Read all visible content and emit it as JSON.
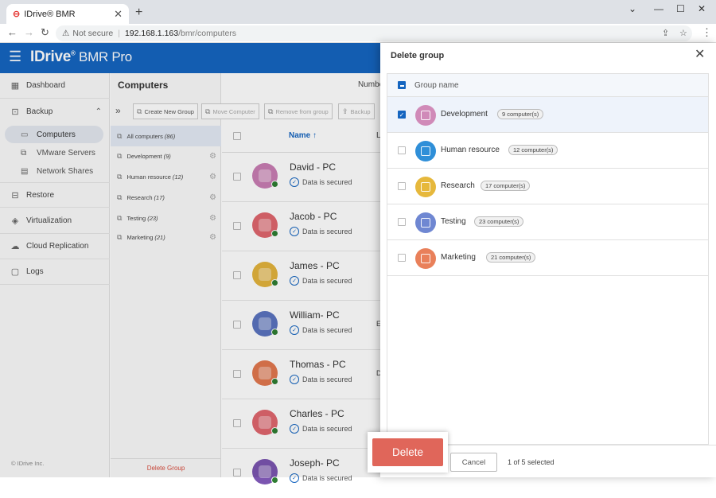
{
  "browser": {
    "tab_title": "IDrive® BMR",
    "tab_close": "✕",
    "new_tab": "+",
    "not_secure": "Not secure",
    "url_host": "192.168.1.163",
    "url_path": "/bmr/computers"
  },
  "app": {
    "logo_main": "IDrive",
    "logo_reg": "®",
    "logo_product": " BMR Pro",
    "copyright": "© IDrive Inc."
  },
  "sidebar": {
    "dashboard": "Dashboard",
    "backup": "Backup",
    "computers": "Computers",
    "vmware": "VMware Servers",
    "network_shares": "Network Shares",
    "restore": "Restore",
    "virtualization": "Virtualization",
    "cloud_replication": "Cloud Replication",
    "logs": "Logs"
  },
  "main": {
    "title": "Computers",
    "number_label": "Numbe",
    "toolbar": {
      "create_group": "Create New Group",
      "move_computer": "Move Computer",
      "remove_group": "Remove from group",
      "backup": "Backup"
    },
    "groups": [
      {
        "name": "All computers",
        "count": "(86)"
      },
      {
        "name": "Development",
        "count": "(9)"
      },
      {
        "name": "Human resource",
        "count": "(12)"
      },
      {
        "name": "Research",
        "count": "(17)"
      },
      {
        "name": "Testing",
        "count": "(23)"
      },
      {
        "name": "Marketing",
        "count": "(21)"
      }
    ],
    "delete_group": "Delete Group",
    "table_header_name": "Name ↑",
    "table_header_next": "L",
    "computers": [
      {
        "name": "David - PC",
        "status": "Data is secured",
        "trunc": "",
        "color": "#c97db3"
      },
      {
        "name": "Jacob - PC",
        "status": "Data is secured",
        "trunc": "",
        "color": "#e0666e"
      },
      {
        "name": "James - PC",
        "status": "Data is secured",
        "trunc": "",
        "color": "#e3b43c"
      },
      {
        "name": "William- PC",
        "status": "Data is secured",
        "trunc": "E",
        "color": "#5b73bf"
      },
      {
        "name": "Thomas - PC",
        "status": "Data is secured",
        "trunc": "D",
        "color": "#e2784f"
      },
      {
        "name": "Charles - PC",
        "status": "Data is secured",
        "trunc": "",
        "color": "#e0666e"
      },
      {
        "name": "Joseph- PC",
        "status": "Data is secured",
        "trunc": "",
        "color": "#7b55b0"
      }
    ]
  },
  "modal": {
    "title": "Delete group",
    "header_label": "Group name",
    "groups": [
      {
        "name": "Development",
        "count": "9 computer(s)",
        "color": "#d08ab8",
        "selected": true
      },
      {
        "name": "Human resource",
        "count": "12 computer(s)",
        "color": "#2f8fd8",
        "selected": false
      },
      {
        "name": "Research",
        "count": "17 computer(s)",
        "color": "#e6b83c",
        "selected": false
      },
      {
        "name": "Testing",
        "count": "23 computer(s)",
        "color": "#6f87d2",
        "selected": false
      },
      {
        "name": "Marketing",
        "count": "21 computer(s)",
        "color": "#e9805a",
        "selected": false
      }
    ],
    "delete_label": "Delete",
    "cancel_label": "Cancel",
    "selected_count": "1 of 5 selected"
  }
}
